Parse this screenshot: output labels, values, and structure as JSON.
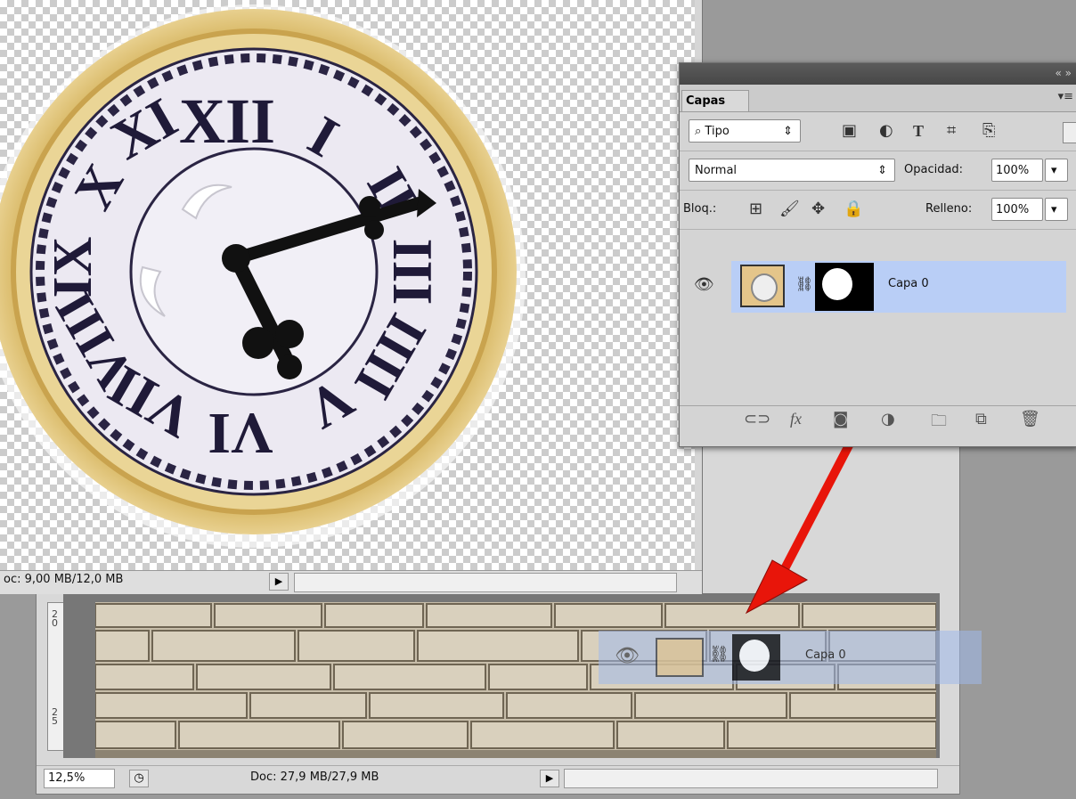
{
  "front_doc": {
    "status_text": "oc: 9,00 MB/12,0 MB"
  },
  "back_doc": {
    "zoom": "12,5%",
    "status_text": "Doc: 27,9 MB/27,9 MB",
    "ruler_top": "2\n0",
    "ruler_bottom": "2\n5"
  },
  "panel": {
    "tab": "Capas",
    "collapse_glyph": "«  »",
    "menu_glyph": "▾≡",
    "filter": {
      "label": "Tipo",
      "icon": "search-icon"
    },
    "filter_icons": [
      "image-icon",
      "adjustment-icon",
      "type-icon",
      "shape-icon",
      "smart-object-icon"
    ],
    "blend_mode": "Normal",
    "opacity_label": "Opacidad:",
    "opacity_value": "100%",
    "lock_label": "Bloq.:",
    "lock_icons": [
      "lock-transparent-icon",
      "lock-paint-icon",
      "lock-move-icon",
      "lock-all-icon"
    ],
    "fill_label": "Relleno:",
    "fill_value": "100%",
    "layer": {
      "name": "Capa 0"
    },
    "bottom_icons": [
      "link-icon",
      "fx-icon",
      "mask-icon",
      "adjustment-icon",
      "folder-icon",
      "new-layer-icon",
      "trash-icon"
    ]
  },
  "ghost_layer": {
    "name": "Capa 0"
  },
  "colors": {
    "arrow": "#e8150a",
    "selection": "#b9cef6",
    "panel_bg": "#d4d4d4"
  }
}
